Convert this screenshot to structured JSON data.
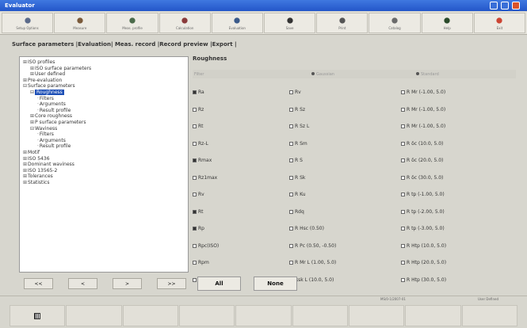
{
  "window": {
    "title": "Evaluator"
  },
  "toolbar": [
    {
      "label": "Setup Options",
      "icon": "settings-icon"
    },
    {
      "label": "Measure",
      "icon": "measure-icon"
    },
    {
      "label": "Meas. profile",
      "icon": "profile-icon"
    },
    {
      "label": "Calculation",
      "icon": "calc-icon"
    },
    {
      "label": "Evaluation",
      "icon": "eval-icon"
    },
    {
      "label": "Save",
      "icon": "save-icon"
    },
    {
      "label": "Print",
      "icon": "print-icon"
    },
    {
      "label": "Catalog",
      "icon": "catalog-icon"
    },
    {
      "label": "Help",
      "icon": "help-icon"
    },
    {
      "label": "Exit",
      "icon": "exit-icon"
    }
  ],
  "tabs_text": "Surface parameters |Evaluation| Meas. record |Record preview |Export |",
  "tree": [
    {
      "label": "ISO profiles",
      "depth": 0,
      "pm": "+"
    },
    {
      "label": "ISO surface parameters",
      "depth": 1,
      "pm": "+"
    },
    {
      "label": "User defined",
      "depth": 1,
      "pm": "+"
    },
    {
      "label": "Pre-evaluation",
      "depth": 0,
      "pm": "+"
    },
    {
      "label": "Surface parameters",
      "depth": 0,
      "pm": "-"
    },
    {
      "label": "Roughness",
      "depth": 1,
      "pm": "-",
      "selected": true
    },
    {
      "label": "Filters",
      "depth": 2,
      "pm": ""
    },
    {
      "label": "Arguments",
      "depth": 2,
      "pm": ""
    },
    {
      "label": "Result profile",
      "depth": 2,
      "pm": ""
    },
    {
      "label": "Core roughness",
      "depth": 1,
      "pm": "+"
    },
    {
      "label": "P surface parameters",
      "depth": 1,
      "pm": "+"
    },
    {
      "label": "Waviness",
      "depth": 1,
      "pm": "-"
    },
    {
      "label": "Filters",
      "depth": 2,
      "pm": ""
    },
    {
      "label": "Arguments",
      "depth": 2,
      "pm": ""
    },
    {
      "label": "Result profile",
      "depth": 2,
      "pm": ""
    },
    {
      "label": "Motif",
      "depth": 0,
      "pm": "+"
    },
    {
      "label": "ISO 5436",
      "depth": 0,
      "pm": "+"
    },
    {
      "label": "Dominant waviness",
      "depth": 0,
      "pm": "+"
    },
    {
      "label": "ISO 13565-2",
      "depth": 0,
      "pm": "+"
    },
    {
      "label": "Tolerances",
      "depth": 0,
      "pm": "+"
    },
    {
      "label": "Statistics",
      "depth": 0,
      "pm": "+"
    }
  ],
  "nav_buttons": [
    "<<",
    "<",
    ">",
    ">>"
  ],
  "panel": {
    "title": "Roughness",
    "subheader": {
      "label": "Filter",
      "opt1": "Gaussian",
      "opt2": "Standard"
    },
    "columns": [
      [
        {
          "label": "Ra",
          "checked": true
        },
        {
          "label": "Rz",
          "checked": false
        },
        {
          "label": "Rt",
          "checked": false
        },
        {
          "label": "Rz-L",
          "checked": false
        },
        {
          "label": "Rmax",
          "checked": true
        },
        {
          "label": "Rz1max",
          "checked": false
        },
        {
          "label": "Rv",
          "checked": false
        },
        {
          "label": "Rt",
          "checked": true
        },
        {
          "label": "Rp",
          "checked": true
        },
        {
          "label": "Rpc(ISO)",
          "checked": false
        },
        {
          "label": "Rpm",
          "checked": false
        },
        {
          "label": "Rp-L",
          "checked": false
        }
      ],
      [
        {
          "label": "Rv",
          "checked": false
        },
        {
          "label": "R Sz",
          "checked": false
        },
        {
          "label": "R Sz L",
          "checked": false
        },
        {
          "label": "R Sm",
          "checked": false
        },
        {
          "label": "R S",
          "checked": false
        },
        {
          "label": "R Sk",
          "checked": false
        },
        {
          "label": "R Ku",
          "checked": false
        },
        {
          "label": "Rdq",
          "checked": false
        },
        {
          "label": "R Hsc (0.50)",
          "checked": false
        },
        {
          "label": "R Pc (0.50, -0.50)",
          "checked": false
        },
        {
          "label": "R Mr L (1.00, 5.0)",
          "checked": false
        },
        {
          "label": "Rsk L (10.0, 5.0)",
          "checked": false
        }
      ],
      [
        {
          "label": "R Mr (-1.00, 5.0)",
          "checked": false
        },
        {
          "label": "R Mr (-1.00, 5.0)",
          "checked": false
        },
        {
          "label": "R Mr (-1.00, 5.0)",
          "checked": false
        },
        {
          "label": "R δc (10.0, 5.0)",
          "checked": false
        },
        {
          "label": "R δc (20.0, 5.0)",
          "checked": false
        },
        {
          "label": "R δc (30.0, 5.0)",
          "checked": false
        },
        {
          "label": "R tp (-1.00, 5.0)",
          "checked": false
        },
        {
          "label": "R tp (-2.00, 5.0)",
          "checked": false
        },
        {
          "label": "R tp (-3.00, 5.0)",
          "checked": false
        },
        {
          "label": "R Htp (10.0, 5.0)",
          "checked": false
        },
        {
          "label": "R Htp (20.0, 5.0)",
          "checked": false
        },
        {
          "label": "R Htp (30.0, 5.0)",
          "checked": false
        }
      ]
    ]
  },
  "buttons": {
    "all": "All",
    "none": "None"
  },
  "status": {
    "left": "MS/0-1/2007-01",
    "right": "User Defined"
  },
  "bottom_buttons": [
    "",
    "",
    "",
    "",
    "",
    "",
    "",
    "",
    ""
  ]
}
